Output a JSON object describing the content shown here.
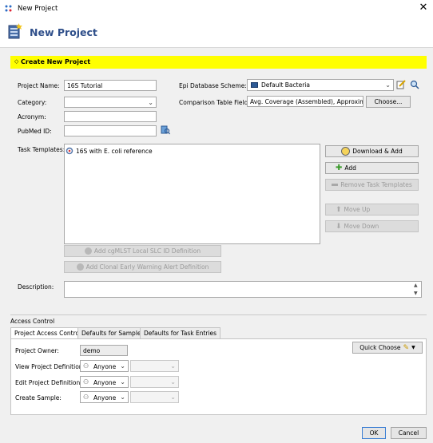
{
  "window": {
    "title": "New Project",
    "close_icon": "close-icon"
  },
  "header": {
    "title": "New Project"
  },
  "banner": {
    "title": "Create New Project"
  },
  "form": {
    "project_name_label": "Project Name:",
    "project_name_value": "16S Tutorial",
    "category_label": "Category:",
    "category_value": "",
    "acronym_label": "Acronym:",
    "acronym_value": "",
    "pubmed_label": "PubMed ID:",
    "pubmed_value": "",
    "epi_label": "Epi Database Scheme:",
    "epi_value": "Default Bacteria",
    "comparison_label": "Comparison Table Fields:",
    "comparison_value": "Avg. Coverage (Assembled), Approximate",
    "choose_button": "Choose...",
    "task_templates_label": "Task Templates:",
    "task_templates": [
      "16S with E. coli reference"
    ],
    "description_label": "Description:",
    "description_value": ""
  },
  "task_buttons": {
    "download_add": "Download & Add",
    "add": "Add",
    "remove": "Remove Task Templates",
    "move_up": "Move Up",
    "move_down": "Move Down",
    "add_cgmlst": "Add cgMLST Local SLC ID Definition",
    "add_clonal": "Add Clonal Early Warning Alert Definition"
  },
  "access": {
    "section_title": "Access Control",
    "tabs": [
      "Project Access Control",
      "Defaults for Samples",
      "Defaults for Task Entries"
    ],
    "active_tab": 0,
    "owner_label": "Project Owner:",
    "owner_value": "demo",
    "quick_choose": "Quick Choose",
    "rows": [
      {
        "label": "View Project Definition:",
        "value": "Anyone"
      },
      {
        "label": "Edit Project Definition:",
        "value": "Anyone"
      },
      {
        "label": "Create Sample:",
        "value": "Anyone"
      }
    ]
  },
  "footer": {
    "ok": "OK",
    "cancel": "Cancel"
  },
  "colors": {
    "banner": "#ffff00",
    "title": "#2f4f8a",
    "green_plus": "#3a9a2a"
  }
}
